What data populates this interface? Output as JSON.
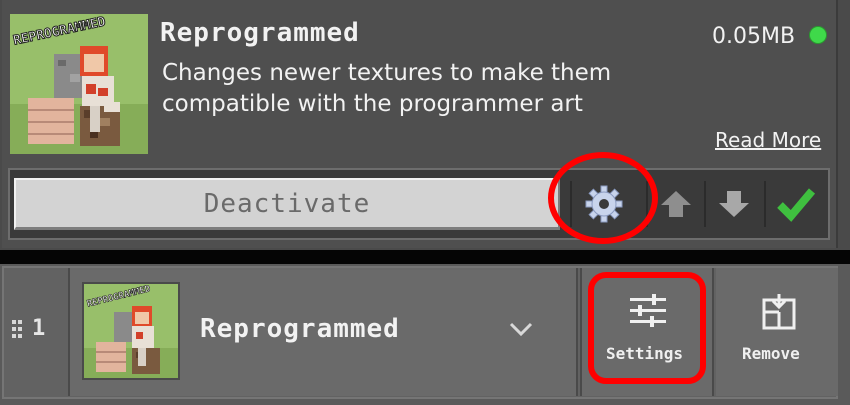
{
  "pack": {
    "title": "Reprogrammed",
    "description": "Changes newer textures to make them compatible with the programmer art",
    "size": "0.05MB",
    "read_more_label": "Read More",
    "thumbnail_logo_text": "REPROGRAMMED"
  },
  "controls": {
    "deactivate_label": "Deactivate",
    "settings_icon": "gear-icon",
    "move_up_icon": "arrow-up-icon",
    "move_down_icon": "arrow-down-icon",
    "active_icon": "checkmark-icon"
  },
  "active_row": {
    "index": "1",
    "title": "Reprogrammed",
    "settings_label": "Settings",
    "remove_label": "Remove"
  },
  "colors": {
    "status_online": "#3fd94a",
    "checkmark": "#3fbf3f",
    "annotation": "#ff0000"
  }
}
